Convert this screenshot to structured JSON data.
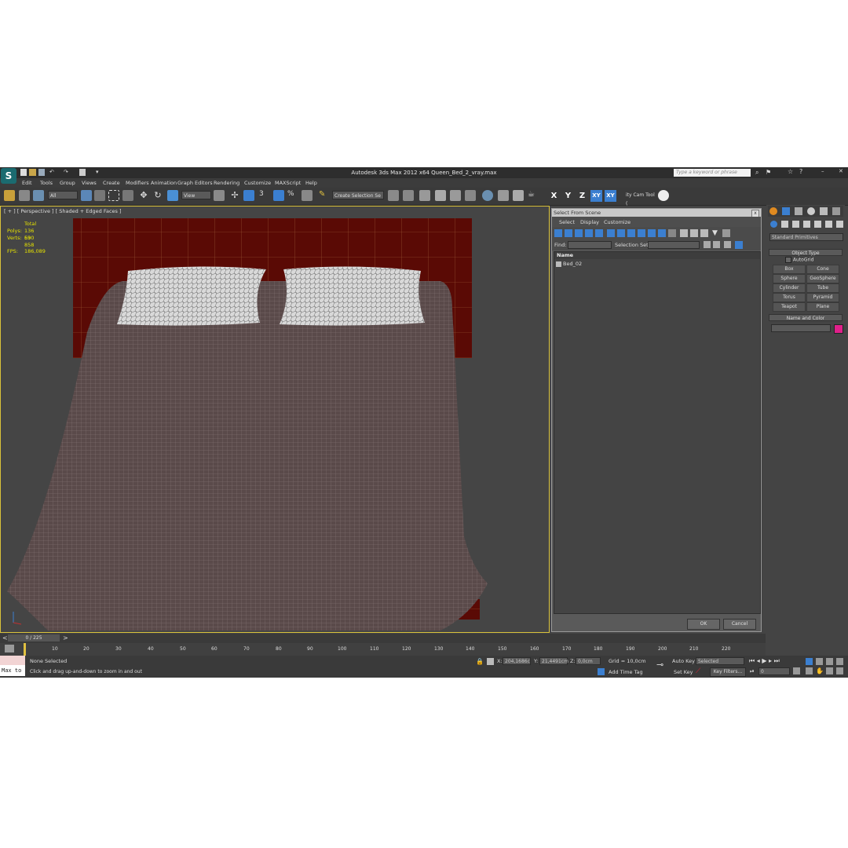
{
  "app": {
    "title": "Autodesk 3ds Max  2012 x64     Queen_Bed_2_vray.max",
    "help_placeholder": "Type a keyword or phrase",
    "logo_glyph": "S"
  },
  "menu": [
    "Edit",
    "Tools",
    "Group",
    "Views",
    "Create",
    "Modifiers",
    "Animation",
    "Graph Editors",
    "Rendering",
    "Customize",
    "MAXScript",
    "Help"
  ],
  "toolbar": {
    "filter_select": "All",
    "view_select": "View",
    "snap_label": "3",
    "angle_snap_label": "%",
    "selection_set": "Create Selection Se",
    "axes": [
      "X",
      "Y",
      "Z",
      "XY",
      "XY"
    ],
    "cam_tool": "ity Cam Tool ("
  },
  "viewport": {
    "label": "[ + ] [ Perspective ] [ Shaded + Edged Faces ]",
    "stats": {
      "total_label": "Total",
      "polys_label": "Polys:",
      "polys_value": "136 530",
      "verts_label": "Verts:",
      "verts_value": "69 858",
      "fps_label": "FPS:",
      "fps_value": "186,089"
    },
    "colors": {
      "headboard": "#5a0a05",
      "blanket": "#5a4a4a",
      "pillow": "#d9d9d9",
      "border": "#d9c23a"
    }
  },
  "dialog": {
    "title": "Select From Scene",
    "close": "x",
    "menu": [
      "Select",
      "Display",
      "Customize"
    ],
    "find_label": "Find:",
    "selection_set_label": "Selection Set:",
    "column_name": "Name",
    "items": [
      "Bed_02"
    ],
    "ok_label": "OK",
    "cancel_label": "Cancel"
  },
  "command_panel": {
    "category": "Standard Primitives",
    "object_type_title": "Object Type",
    "autogrid_label": "AutoGrid",
    "buttons": [
      "Box",
      "Cone",
      "Sphere",
      "GeoSphere",
      "Cylinder",
      "Tube",
      "Torus",
      "Pyramid",
      "Teapot",
      "Plane"
    ],
    "name_color_title": "Name and Color",
    "object_color": "#e0208a"
  },
  "timeline": {
    "frame_range": "0 / 225",
    "ticks": [
      "10",
      "20",
      "30",
      "40",
      "50",
      "60",
      "70",
      "80",
      "90",
      "100",
      "110",
      "120",
      "130",
      "140",
      "150",
      "160",
      "170",
      "180",
      "190",
      "200",
      "210",
      "220"
    ]
  },
  "status": {
    "script_box": "Max to",
    "selected_text": "None Selected",
    "prompt_text": "Click and drag up-and-down to zoom in and out",
    "x_label": "X:",
    "x_value": "204,1686c",
    "y_label": "Y:",
    "y_value": "21,4491cm",
    "z_label": "Z:",
    "z_value": "0,0cm",
    "grid_text": "Grid = 10,0cm",
    "add_time_tag": "Add Time Tag",
    "auto_key": "Auto Key",
    "set_key": "Set Key",
    "selected_dropdown": "Selected",
    "key_filters": "Key Filters...",
    "current_frame": "0"
  }
}
